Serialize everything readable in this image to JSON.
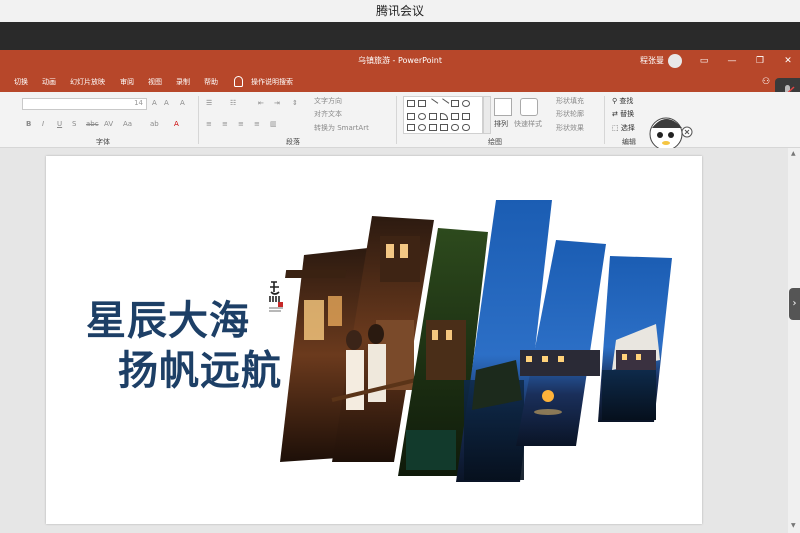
{
  "meeting": {
    "title": "腾讯会议"
  },
  "ppt": {
    "file_title": "乌镇旅游 - PowerPoint",
    "user_name": "程张曼",
    "window_buttons": [
      "▭",
      "—",
      "❐",
      "✕"
    ]
  },
  "tabs": [
    "切换",
    "动画",
    "幻灯片放映",
    "审阅",
    "视图",
    "录制",
    "帮助",
    "操作说明搜索"
  ],
  "ribbon": {
    "font_size": "14",
    "groups": [
      "字体",
      "段落",
      "绘图",
      "编辑"
    ],
    "font_tools": [
      "B",
      "I",
      "U",
      "S",
      "abc",
      "AV",
      "Aa",
      "A"
    ],
    "paragraph_tools": [
      "文字方向",
      "对齐文本",
      "转换为 SmartArt"
    ],
    "drawing_tools": [
      "排列",
      "快速样式",
      "形状填充",
      "形状轮廓",
      "形状效果"
    ],
    "editing_tools": [
      "查找",
      "替换",
      "选择"
    ]
  },
  "slide": {
    "headline_line1": "星辰大海",
    "headline_line2": "扬帆远航"
  },
  "colors": {
    "ppt_accent": "#b7472a",
    "headline": "#1d3f66"
  },
  "icons": [
    "lightbulb-icon",
    "search-icon",
    "mic-icon",
    "avatar-icon",
    "mascot-icon"
  ]
}
